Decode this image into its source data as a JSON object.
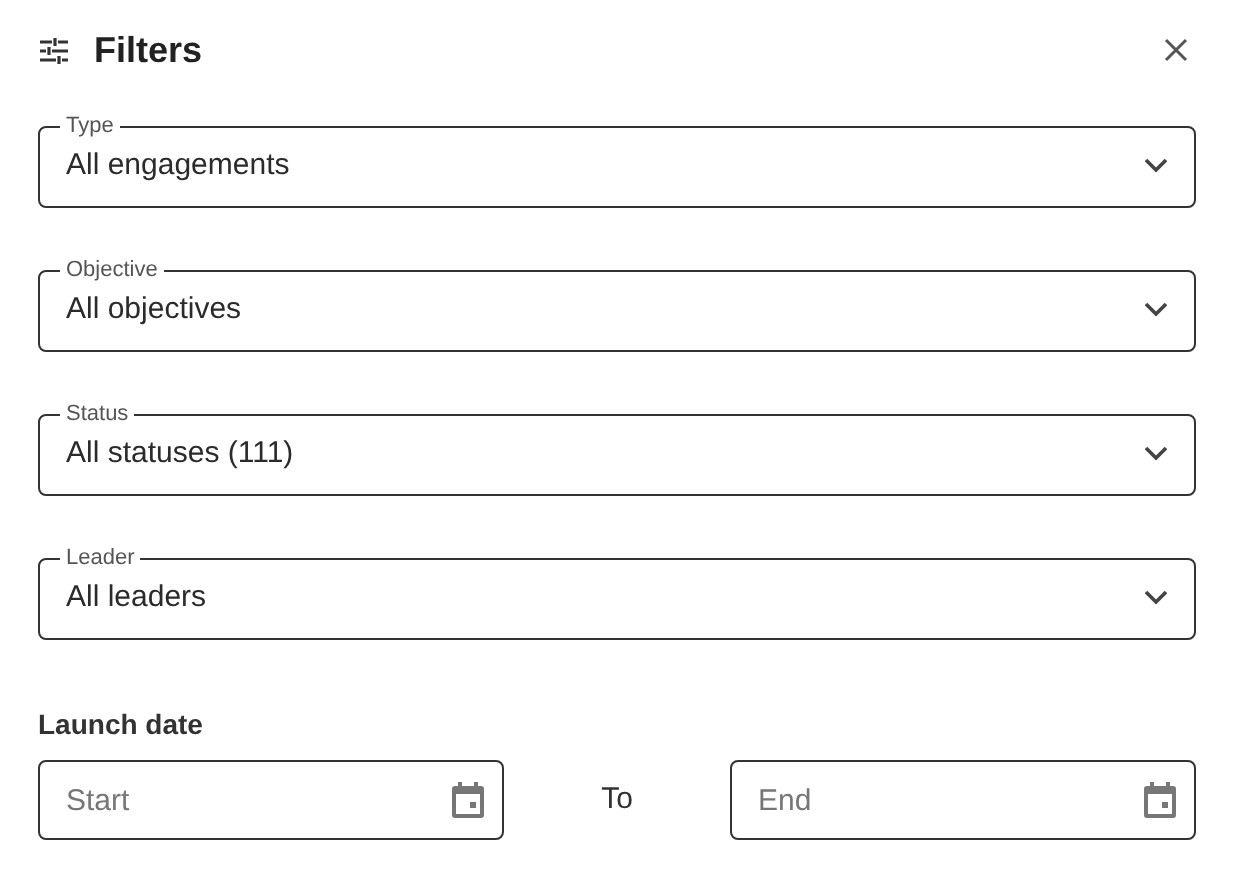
{
  "header": {
    "title": "Filters"
  },
  "selects": [
    {
      "label": "Type",
      "value": "All engagements"
    },
    {
      "label": "Objective",
      "value": "All objectives"
    },
    {
      "label": "Status",
      "value": "All statuses (111)"
    },
    {
      "label": "Leader",
      "value": "All leaders"
    }
  ],
  "launch_date": {
    "label": "Launch date",
    "start": {
      "placeholder": "Start"
    },
    "separator": "To",
    "end": {
      "placeholder": "End"
    }
  }
}
